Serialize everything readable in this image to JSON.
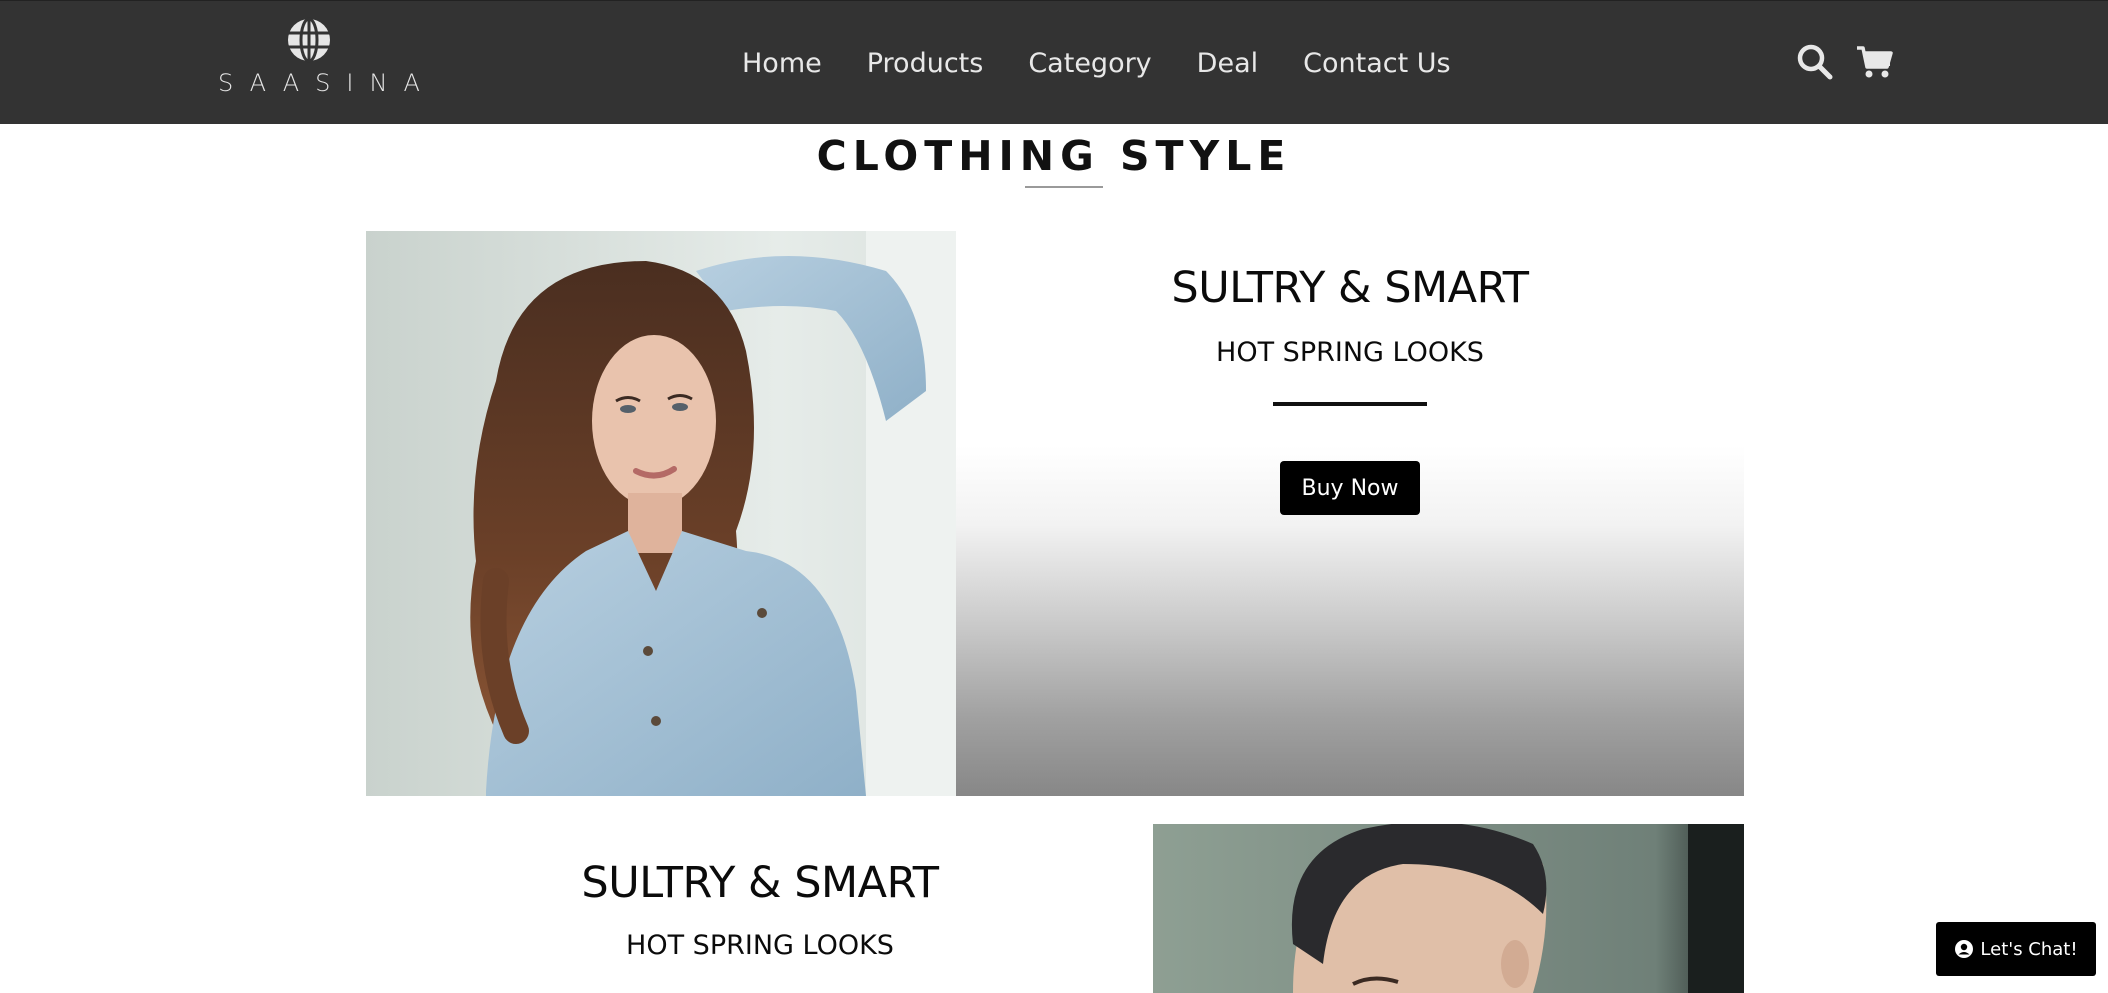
{
  "brand": {
    "name": "SAASINA",
    "icon": "globe-icon"
  },
  "nav": {
    "items": [
      {
        "label": "Home"
      },
      {
        "label": "Products"
      },
      {
        "label": "Category"
      },
      {
        "label": "Deal"
      },
      {
        "label": "Contact Us"
      }
    ]
  },
  "header_icons": {
    "search": "search-icon",
    "cart": "cart-icon"
  },
  "section": {
    "title": "CLOTHING STYLE"
  },
  "feature1": {
    "title": "SULTRY & SMART",
    "subtitle": "HOT SPRING LOOKS",
    "button_label": "Buy Now"
  },
  "feature2": {
    "title": "SULTRY & SMART",
    "subtitle": "HOT SPRING LOOKS"
  },
  "chat": {
    "label": "Let's Chat!",
    "icon": "user-circle-icon"
  },
  "colors": {
    "header_bg": "#333333",
    "nav_text": "#e8e8e8",
    "button_bg": "#000000",
    "button_text": "#ffffff"
  }
}
